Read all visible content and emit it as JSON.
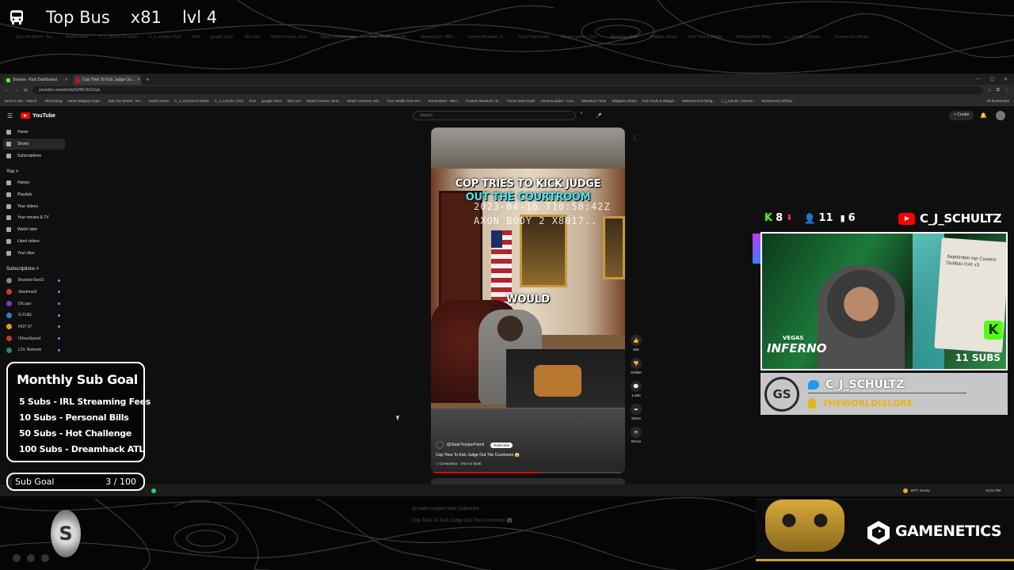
{
  "overlay": {
    "title": "Top Bus",
    "multiplier": "x81",
    "level": "lvl 4"
  },
  "ghost_tabs": [
    "Spin the Wheel - Ra...",
    "Switch Items",
    "C_J_SCHULTZ twitch",
    "C_J_schultz | Kick",
    "Kick",
    "google Voice",
    "Wix.com",
    "Watch movies, serie...",
    "Watch cartoons onli...",
    "Your Health Care Re...",
    "StreamEast - NBA...",
    "Custom Rewards | E...",
    "Cricut Heat Guide",
    "StreamLadder - Con...",
    "Marathon Timer",
    "Widgets Library",
    "Kick Tools & Widge...",
    "MrBoost Kick Widg...",
    "c_j_schultz | Stream...",
    "Streamcord Official..."
  ],
  "browser": {
    "tabs": [
      {
        "label": "Stream - Kick Dashboard",
        "color": "#53fc18"
      },
      {
        "label": "Cop Tries To Kick Judge Ou...",
        "color": "#ff0000"
      }
    ],
    "url": "youtube.com/shorts/GHRC6CZoyk",
    "bookmarks": [
      "Nerd or Die - Switch...",
      "IRLhosting",
      "Heart Widgets Hype...",
      "Spin the Wheel - Ra...",
      "Switch Items",
      "C_J_SCHULTZ twitch",
      "C_J_schultz | Kick",
      "Kick",
      "google Voice",
      "Wix.com",
      "Watch movies, serie...",
      "Watch cartoons onli...",
      "Your Health Care Re...",
      "StreamEast - NBA...",
      "Custom Rewards | E...",
      "Cricut Heat Guide",
      "StreamLadder - Con...",
      "Marathon Timer",
      "Widgets Library",
      "Kick Tools & Widget...",
      "MrBoost Kick Widg...",
      "c_j_schultz | Stream...",
      "Streamcord Official..."
    ],
    "all_bookmarks": "All Bookmarks"
  },
  "youtube": {
    "logo": "YouTube",
    "search_placeholder": "Search",
    "create": "+ Create",
    "sidebar_main": [
      {
        "label": "Home",
        "active": false
      },
      {
        "label": "Shorts",
        "active": true
      },
      {
        "label": "Subscriptions",
        "active": false
      }
    ],
    "you_heading": "You  >",
    "sidebar_you": [
      "History",
      "Playlists",
      "Your videos",
      "Your movies & TV",
      "Watch later",
      "Liked videos",
      "Your clips"
    ],
    "subscriptions_heading": "Subscriptions  >",
    "subscriptions": [
      {
        "name": "BrandonTan91",
        "color": "#888"
      },
      {
        "name": "deadmau5",
        "color": "#d23b3b"
      },
      {
        "name": "DrLupo",
        "color": "#6b3dd1"
      },
      {
        "name": "G FUEL",
        "color": "#2f7bd8"
      },
      {
        "name": "HOT 97",
        "color": "#e0a020"
      },
      {
        "name": "IShowSpeed",
        "color": "#c0392b"
      },
      {
        "name": "LOL Network",
        "color": "#2e8b57"
      }
    ],
    "short": {
      "caption_line1": "COP TRIES TO KICK JUDGE",
      "caption_line2": "OUT THE COURTROOM",
      "timestamp": "2023-04-16  T10:58:42Z",
      "bodycam": "AXON BODY 2  X8017..",
      "caption_word": "WOULD",
      "channel": "@StateTrooperPatrol",
      "subscribe": "Subscribe",
      "title": "Cop Tries To Kick Judge Out The Courtroom 😱",
      "audio": "♫ Conspiracy · JVLA & Spoti",
      "progress": 0.55
    },
    "actions": [
      {
        "icon": "👍",
        "label": "96K",
        "name": "like"
      },
      {
        "icon": "👎",
        "label": "Dislike",
        "name": "dislike"
      },
      {
        "icon": "💬",
        "label": "1,960",
        "name": "comments"
      },
      {
        "icon": "➦",
        "label": "Share",
        "name": "share"
      },
      {
        "icon": "⟳",
        "label": "Remix",
        "name": "remix"
      }
    ]
  },
  "taskbar": {
    "weather": "89°F Sunny",
    "clock": "12:21 PM"
  },
  "sub_goal": {
    "title": "Monthly Sub Goal",
    "items": [
      "5 Subs - IRL Streaming Fees",
      "10 Subs - Personal Bills",
      "50 Subs - Hot Challenge",
      "100 Subs - Dreamhack ATL"
    ],
    "bar_label": "Sub Goal",
    "bar_count": "3 / 100",
    "current": 3,
    "target": 100
  },
  "stream_stats": {
    "kick_count": "8",
    "followers": "11",
    "viewers": "6"
  },
  "youtube_handle": "C_J_SCHULTZ",
  "webcam": {
    "vegas": "VEGAS",
    "inferno": "INFERNO",
    "subs": "11 SUBS",
    "board_text": "September top Content Dubbas KxK x3"
  },
  "social": {
    "twitter": "C_J_SCHULTZ",
    "patreon": "THEWORLDISLORE",
    "logo_text": "GS"
  },
  "sponsor": {
    "name": "GAMENETICS"
  },
  "lower_logo": "S",
  "ghost_short": {
    "channel": "@StateTrooperPatrol  Subscribe",
    "title": "Cop Tries To Kick Judge Out The Courtroom 😱",
    "audio": "♫ Conspiracy · JVLA & Spoti"
  },
  "colors": {
    "kick_green": "#53fc18",
    "youtube_red": "#ff0000",
    "caption_cyan": "#4fe3f0",
    "patreon_gold": "#e7b418"
  }
}
